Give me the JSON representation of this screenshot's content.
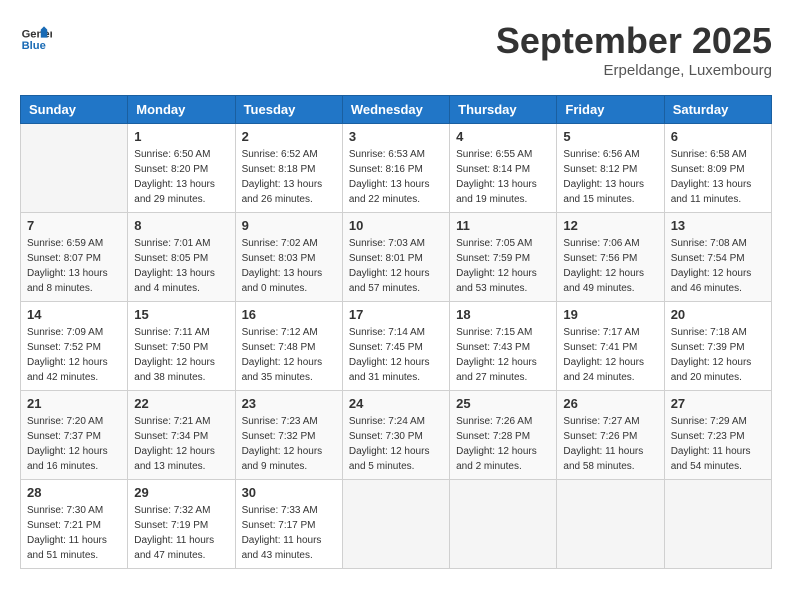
{
  "header": {
    "logo_line1": "General",
    "logo_line2": "Blue",
    "month": "September 2025",
    "location": "Erpeldange, Luxembourg"
  },
  "days_of_week": [
    "Sunday",
    "Monday",
    "Tuesday",
    "Wednesday",
    "Thursday",
    "Friday",
    "Saturday"
  ],
  "weeks": [
    [
      {
        "day": "",
        "info": ""
      },
      {
        "day": "1",
        "info": "Sunrise: 6:50 AM\nSunset: 8:20 PM\nDaylight: 13 hours\nand 29 minutes."
      },
      {
        "day": "2",
        "info": "Sunrise: 6:52 AM\nSunset: 8:18 PM\nDaylight: 13 hours\nand 26 minutes."
      },
      {
        "day": "3",
        "info": "Sunrise: 6:53 AM\nSunset: 8:16 PM\nDaylight: 13 hours\nand 22 minutes."
      },
      {
        "day": "4",
        "info": "Sunrise: 6:55 AM\nSunset: 8:14 PM\nDaylight: 13 hours\nand 19 minutes."
      },
      {
        "day": "5",
        "info": "Sunrise: 6:56 AM\nSunset: 8:12 PM\nDaylight: 13 hours\nand 15 minutes."
      },
      {
        "day": "6",
        "info": "Sunrise: 6:58 AM\nSunset: 8:09 PM\nDaylight: 13 hours\nand 11 minutes."
      }
    ],
    [
      {
        "day": "7",
        "info": "Sunrise: 6:59 AM\nSunset: 8:07 PM\nDaylight: 13 hours\nand 8 minutes."
      },
      {
        "day": "8",
        "info": "Sunrise: 7:01 AM\nSunset: 8:05 PM\nDaylight: 13 hours\nand 4 minutes."
      },
      {
        "day": "9",
        "info": "Sunrise: 7:02 AM\nSunset: 8:03 PM\nDaylight: 13 hours\nand 0 minutes."
      },
      {
        "day": "10",
        "info": "Sunrise: 7:03 AM\nSunset: 8:01 PM\nDaylight: 12 hours\nand 57 minutes."
      },
      {
        "day": "11",
        "info": "Sunrise: 7:05 AM\nSunset: 7:59 PM\nDaylight: 12 hours\nand 53 minutes."
      },
      {
        "day": "12",
        "info": "Sunrise: 7:06 AM\nSunset: 7:56 PM\nDaylight: 12 hours\nand 49 minutes."
      },
      {
        "day": "13",
        "info": "Sunrise: 7:08 AM\nSunset: 7:54 PM\nDaylight: 12 hours\nand 46 minutes."
      }
    ],
    [
      {
        "day": "14",
        "info": "Sunrise: 7:09 AM\nSunset: 7:52 PM\nDaylight: 12 hours\nand 42 minutes."
      },
      {
        "day": "15",
        "info": "Sunrise: 7:11 AM\nSunset: 7:50 PM\nDaylight: 12 hours\nand 38 minutes."
      },
      {
        "day": "16",
        "info": "Sunrise: 7:12 AM\nSunset: 7:48 PM\nDaylight: 12 hours\nand 35 minutes."
      },
      {
        "day": "17",
        "info": "Sunrise: 7:14 AM\nSunset: 7:45 PM\nDaylight: 12 hours\nand 31 minutes."
      },
      {
        "day": "18",
        "info": "Sunrise: 7:15 AM\nSunset: 7:43 PM\nDaylight: 12 hours\nand 27 minutes."
      },
      {
        "day": "19",
        "info": "Sunrise: 7:17 AM\nSunset: 7:41 PM\nDaylight: 12 hours\nand 24 minutes."
      },
      {
        "day": "20",
        "info": "Sunrise: 7:18 AM\nSunset: 7:39 PM\nDaylight: 12 hours\nand 20 minutes."
      }
    ],
    [
      {
        "day": "21",
        "info": "Sunrise: 7:20 AM\nSunset: 7:37 PM\nDaylight: 12 hours\nand 16 minutes."
      },
      {
        "day": "22",
        "info": "Sunrise: 7:21 AM\nSunset: 7:34 PM\nDaylight: 12 hours\nand 13 minutes."
      },
      {
        "day": "23",
        "info": "Sunrise: 7:23 AM\nSunset: 7:32 PM\nDaylight: 12 hours\nand 9 minutes."
      },
      {
        "day": "24",
        "info": "Sunrise: 7:24 AM\nSunset: 7:30 PM\nDaylight: 12 hours\nand 5 minutes."
      },
      {
        "day": "25",
        "info": "Sunrise: 7:26 AM\nSunset: 7:28 PM\nDaylight: 12 hours\nand 2 minutes."
      },
      {
        "day": "26",
        "info": "Sunrise: 7:27 AM\nSunset: 7:26 PM\nDaylight: 11 hours\nand 58 minutes."
      },
      {
        "day": "27",
        "info": "Sunrise: 7:29 AM\nSunset: 7:23 PM\nDaylight: 11 hours\nand 54 minutes."
      }
    ],
    [
      {
        "day": "28",
        "info": "Sunrise: 7:30 AM\nSunset: 7:21 PM\nDaylight: 11 hours\nand 51 minutes."
      },
      {
        "day": "29",
        "info": "Sunrise: 7:32 AM\nSunset: 7:19 PM\nDaylight: 11 hours\nand 47 minutes."
      },
      {
        "day": "30",
        "info": "Sunrise: 7:33 AM\nSunset: 7:17 PM\nDaylight: 11 hours\nand 43 minutes."
      },
      {
        "day": "",
        "info": ""
      },
      {
        "day": "",
        "info": ""
      },
      {
        "day": "",
        "info": ""
      },
      {
        "day": "",
        "info": ""
      }
    ]
  ]
}
